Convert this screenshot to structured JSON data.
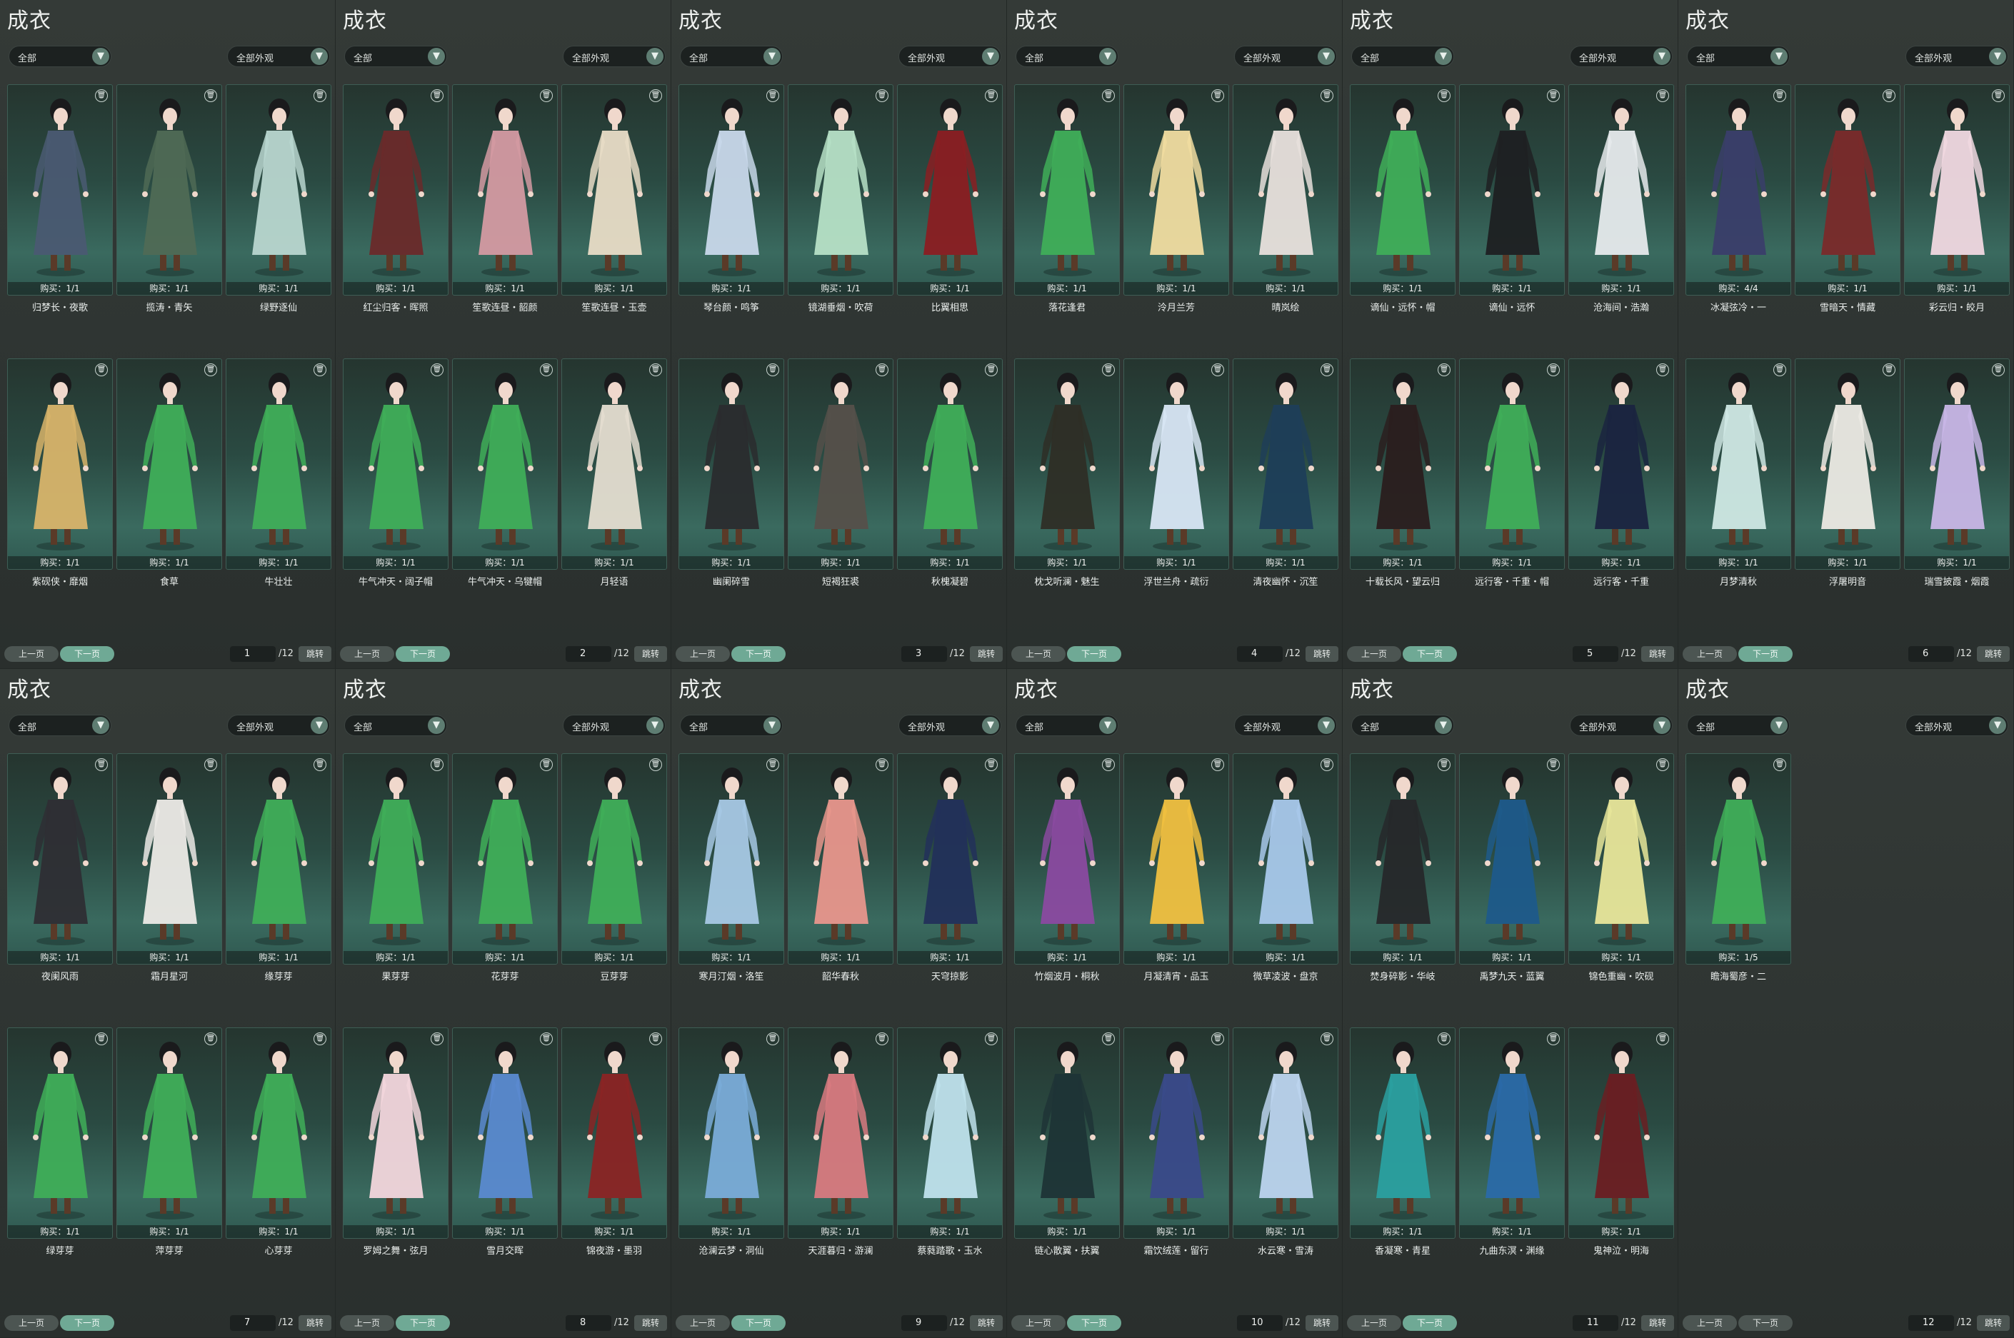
{
  "panels": [
    {
      "title": "成衣",
      "filter_left": "全部",
      "filter_right": "全部外观",
      "prev_label": "上一页",
      "next_label": "下一页",
      "page": "1",
      "total": "/12",
      "jump_label": "跳转",
      "items": [
        {
          "name": "归梦长・夜歌",
          "buy": "购买：1/1",
          "color": "#4a5a72"
        },
        {
          "name": "揽涛・青矢",
          "buy": "购买：1/1",
          "color": "#4f6a55"
        },
        {
          "name": "绿野逐仙",
          "buy": "购买：1/1",
          "color": "#b8d6cf"
        },
        {
          "name": "紫砚侠・靡烟",
          "buy": "购买：1/1",
          "color": "#d8b46a"
        },
        {
          "name": "食草",
          "buy": "购买：1/1",
          "color": "#3fae58"
        },
        {
          "name": "牛壮壮",
          "buy": "购买：1/1",
          "color": "#3fae58"
        }
      ]
    },
    {
      "title": "成衣",
      "filter_left": "全部",
      "filter_right": "全部外观",
      "prev_label": "上一页",
      "next_label": "下一页",
      "page": "2",
      "total": "/12",
      "jump_label": "跳转",
      "items": [
        {
          "name": "红尘归客・晖照",
          "buy": "购买：1/1",
          "color": "#6a2a2a"
        },
        {
          "name": "笙歌连昼・韶颜",
          "buy": "购买：1/1",
          "color": "#d49aa2"
        },
        {
          "name": "笙歌连昼・玉壶",
          "buy": "购买：1/1",
          "color": "#e8dcc6"
        },
        {
          "name": "牛气冲天・阔子帽",
          "buy": "购买：1/1",
          "color": "#3fae58"
        },
        {
          "name": "牛气冲天・乌犍帽",
          "buy": "购买：1/1",
          "color": "#3fae58"
        },
        {
          "name": "月轻语",
          "buy": "购买：1/1",
          "color": "#e4ddd0"
        }
      ]
    },
    {
      "title": "成衣",
      "filter_left": "全部",
      "filter_right": "全部外观",
      "prev_label": "上一页",
      "next_label": "下一页",
      "page": "3",
      "total": "/12",
      "jump_label": "跳转",
      "items": [
        {
          "name": "琴台颜・鸣筝",
          "buy": "购买：1/1",
          "color": "#c8d8ea"
        },
        {
          "name": "镜湖垂烟・吹荷",
          "buy": "购买：1/1",
          "color": "#b6e0c6"
        },
        {
          "name": "比翼相思",
          "buy": "购买：1/1",
          "color": "#8a1e22"
        },
        {
          "name": "幽阑碎雪",
          "buy": "购买：1/1",
          "color": "#2a2c2e"
        },
        {
          "name": "短褐狂裘",
          "buy": "购买：1/1",
          "color": "#55504a"
        },
        {
          "name": "秋槐凝碧",
          "buy": "购买：1/1",
          "color": "#3fae58"
        }
      ]
    },
    {
      "title": "成衣",
      "filter_left": "全部",
      "filter_right": "全部外观",
      "prev_label": "上一页",
      "next_label": "下一页",
      "page": "4",
      "total": "/12",
      "jump_label": "跳转",
      "items": [
        {
          "name": "落花逢君",
          "buy": "购买：1/1",
          "color": "#3fae58"
        },
        {
          "name": "泠月兰芳",
          "buy": "购买：1/1",
          "color": "#f0dca0"
        },
        {
          "name": "晴岚绘",
          "buy": "购买：1/1",
          "color": "#e8e0dc"
        },
        {
          "name": "枕戈听澜・魅生",
          "buy": "购买：1/1",
          "color": "#2e2e26"
        },
        {
          "name": "浮世兰舟・疏衍",
          "buy": "购买：1/1",
          "color": "#d8e6f4"
        },
        {
          "name": "清夜幽怀・沉笙",
          "buy": "购买：1/1",
          "color": "#1e3e58"
        }
      ]
    },
    {
      "title": "成衣",
      "filter_left": "全部",
      "filter_right": "全部外观",
      "prev_label": "上一页",
      "next_label": "下一页",
      "page": "5",
      "total": "/12",
      "jump_label": "跳转",
      "items": [
        {
          "name": "谪仙・远怀・帽",
          "buy": "购买：1/1",
          "color": "#3fae58"
        },
        {
          "name": "谪仙・远怀",
          "buy": "购买：1/1",
          "color": "#1e2022"
        },
        {
          "name": "沧海间・浩瀚",
          "buy": "购买：1/1",
          "color": "#e6eaec"
        },
        {
          "name": "十载长风・望云归",
          "buy": "购买：1/1",
          "color": "#2a1e1e"
        },
        {
          "name": "远行客・千重・帽",
          "buy": "购买：1/1",
          "color": "#3fae58"
        },
        {
          "name": "远行客・千重",
          "buy": "购买：1/1",
          "color": "#1a2440"
        }
      ]
    },
    {
      "title": "成衣",
      "filter_left": "全部",
      "filter_right": "全部外观",
      "prev_label": "上一页",
      "next_label": "下一页",
      "page": "6",
      "total": "/12",
      "jump_label": "跳转",
      "items": [
        {
          "name": "冰凝弦冷・一",
          "buy": "购买：4/4",
          "color": "#3a3e6a"
        },
        {
          "name": "雪暗天・情藏",
          "buy": "购买：1/1",
          "color": "#7a2a2a"
        },
        {
          "name": "彩云归・皎月",
          "buy": "购买：1/1",
          "color": "#f0d8e0"
        },
        {
          "name": "月梦清秋",
          "buy": "购买：1/1",
          "color": "#cfe8e4"
        },
        {
          "name": "浮屠明音",
          "buy": "购买：1/1",
          "color": "#eceae4"
        },
        {
          "name": "瑞雪披霞・烟霞",
          "buy": "购买：1/1",
          "color": "#c8b6e6"
        }
      ]
    },
    {
      "title": "成衣",
      "filter_left": "全部",
      "filter_right": "全部外观",
      "prev_label": "上一页",
      "next_label": "下一页",
      "page": "7",
      "total": "/12",
      "jump_label": "跳转",
      "items": [
        {
          "name": "夜阑风雨",
          "buy": "购买：1/1",
          "color": "#2e2e34"
        },
        {
          "name": "霜月星河",
          "buy": "购买：1/1",
          "color": "#eceae6"
        },
        {
          "name": "缘芽芽",
          "buy": "购买：1/1",
          "color": "#3fae58"
        },
        {
          "name": "绿芽芽",
          "buy": "购买：1/1",
          "color": "#3fae58"
        },
        {
          "name": "萍芽芽",
          "buy": "购买：1/1",
          "color": "#3fae58"
        },
        {
          "name": "心芽芽",
          "buy": "购买：1/1",
          "color": "#3fae58"
        }
      ]
    },
    {
      "title": "成衣",
      "filter_left": "全部",
      "filter_right": "全部外观",
      "prev_label": "上一页",
      "next_label": "下一页",
      "page": "8",
      "total": "/12",
      "jump_label": "跳转",
      "items": [
        {
          "name": "果芽芽",
          "buy": "购买：1/1",
          "color": "#3fae58"
        },
        {
          "name": "花芽芽",
          "buy": "购买：1/1",
          "color": "#3fae58"
        },
        {
          "name": "豆芽芽",
          "buy": "购买：1/1",
          "color": "#3fae58"
        },
        {
          "name": "罗姆之舞・弦月",
          "buy": "购买：1/1",
          "color": "#f2d6dc"
        },
        {
          "name": "雪月交晖",
          "buy": "购买：1/1",
          "color": "#5a8ad0"
        },
        {
          "name": "锦夜游・墨羽",
          "buy": "购买：1/1",
          "color": "#8a2424"
        }
      ]
    },
    {
      "title": "成衣",
      "filter_left": "全部",
      "filter_right": "全部外观",
      "prev_label": "上一页",
      "next_label": "下一页",
      "page": "9",
      "total": "/12",
      "jump_label": "跳转",
      "items": [
        {
          "name": "寒月汀烟・洛笙",
          "buy": "购买：1/1",
          "color": "#a6c8e4"
        },
        {
          "name": "韶华春秋",
          "buy": "购买：1/1",
          "color": "#e8968c"
        },
        {
          "name": "天穹掠影",
          "buy": "购买：1/1",
          "color": "#22305a"
        },
        {
          "name": "沧澜云梦・洞仙",
          "buy": "购买：1/1",
          "color": "#7aacd8"
        },
        {
          "name": "天涯暮归・游澜",
          "buy": "购买：1/1",
          "color": "#d87a80"
        },
        {
          "name": "蔡蕤踏歌・玉水",
          "buy": "购买：1/1",
          "color": "#bfe2ec"
        }
      ]
    },
    {
      "title": "成衣",
      "filter_left": "全部",
      "filter_right": "全部外观",
      "prev_label": "上一页",
      "next_label": "下一页",
      "page": "10",
      "total": "/12",
      "jump_label": "跳转",
      "items": [
        {
          "name": "竹烟波月・桐秋",
          "buy": "购买：1/1",
          "color": "#8a4aa0"
        },
        {
          "name": "月凝清宵・品玉",
          "buy": "购买：1/1",
          "color": "#f0c040"
        },
        {
          "name": "微草凌波・盘京",
          "buy": "购买：1/1",
          "color": "#a8c8ea"
        },
        {
          "name": "链心散翼・扶翼",
          "buy": "购买：1/1",
          "color": "#1e3436"
        },
        {
          "name": "霜饮绒莲・留行",
          "buy": "购买：1/1",
          "color": "#3a4a8a"
        },
        {
          "name": "水云寒・雪涛",
          "buy": "购买：1/1",
          "color": "#bcd4ee"
        }
      ]
    },
    {
      "title": "成衣",
      "filter_left": "全部",
      "filter_right": "全部外观",
      "prev_label": "上一页",
      "next_label": "下一页",
      "page": "11",
      "total": "/12",
      "jump_label": "跳转",
      "items": [
        {
          "name": "焚身碎影・华岐",
          "buy": "购买：1/1",
          "color": "#26282a"
        },
        {
          "name": "禹梦九天・蓝翼",
          "buy": "购买：1/1",
          "color": "#1e5a8a"
        },
        {
          "name": "锦色重幽・吹砚",
          "buy": "购买：1/1",
          "color": "#e8e69a"
        },
        {
          "name": "香凝寒・青星",
          "buy": "购买：1/1",
          "color": "#2aa0a0"
        },
        {
          "name": "九曲东溟・渊缘",
          "buy": "购买：1/1",
          "color": "#2a6aa8"
        },
        {
          "name": "鬼神泣・明海",
          "buy": "购买：1/1",
          "color": "#6a1e22"
        }
      ]
    },
    {
      "title": "成衣",
      "filter_left": "全部",
      "filter_right": "全部外观",
      "prev_label": "上一页",
      "next_label": "下一页",
      "page": "12",
      "total": "/12",
      "jump_label": "跳转",
      "items": [
        {
          "name": "瞻海蜀彦・二",
          "buy": "购买：1/5",
          "color": "#3fae58"
        }
      ]
    }
  ],
  "icons": {
    "chevron": "chevron-down-icon",
    "trash": "trash-icon"
  }
}
